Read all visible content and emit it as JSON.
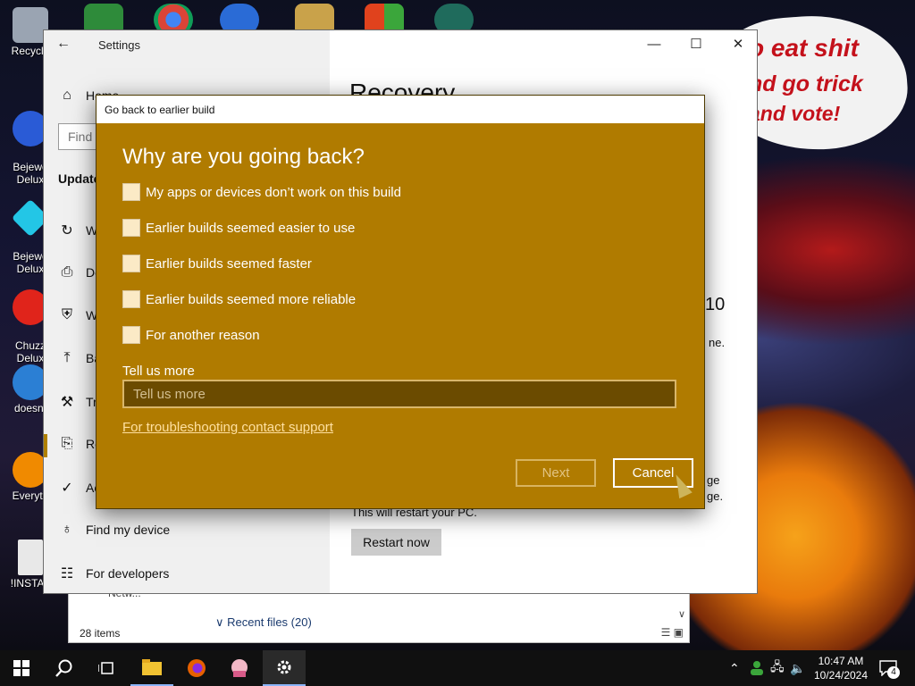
{
  "desktop": {
    "meme_lines": [
      "o eat shit",
      "nd go trick",
      "and vote!"
    ],
    "icons": [
      {
        "label": "Recycle",
        "icon": "recycle-bin-icon"
      },
      {
        "label": "Bejewe\nDelux",
        "icon": "bejeweled-icon"
      },
      {
        "label": "Bejewe\nDelux",
        "icon": "bejeweled-3-icon"
      },
      {
        "label": "Chuzz\nDelux",
        "icon": "chuzzle-icon"
      },
      {
        "label": "doesnt",
        "icon": "bird-icon"
      },
      {
        "label": "Everyth",
        "icon": "everything-search-icon"
      },
      {
        "label": "!INSTAL",
        "icon": "document-icon"
      }
    ]
  },
  "explorer": {
    "item_count": "28 items",
    "recent_files": "∨ Recent files (20)",
    "network_peek": "Netw..."
  },
  "settings": {
    "window_title": "Settings",
    "back_glyph": "←",
    "nav": [
      {
        "label": "Home",
        "icon": "home-icon",
        "glyph": "⌂"
      },
      {
        "label": "W",
        "icon": "sync-icon",
        "glyph": "↻"
      },
      {
        "label": "De",
        "icon": "delivery-icon",
        "glyph": "⎙"
      },
      {
        "label": "W",
        "icon": "shield-icon",
        "glyph": "⛨"
      },
      {
        "label": "Ba",
        "icon": "backup-icon",
        "glyph": "⤒"
      },
      {
        "label": "Tr",
        "icon": "wrench-icon",
        "glyph": "⚒"
      },
      {
        "label": "Re",
        "icon": "recovery-icon",
        "glyph": "⎘"
      },
      {
        "label": "Ac",
        "icon": "check-circle-icon",
        "glyph": "✓"
      },
      {
        "label": "Find my device",
        "icon": "person-pin-icon",
        "glyph": "♁"
      },
      {
        "label": "For developers",
        "icon": "developer-icon",
        "glyph": "☷"
      }
    ],
    "find_placeholder": "Find",
    "section_head": "Update",
    "page_title": "Recovery",
    "peek_10": "10",
    "peek_ne": "ne.",
    "peek_ge1": "ge",
    "peek_ge2": "ge.",
    "restart_note": "This will restart your PC.",
    "restart_button": "Restart now",
    "minimize": "—",
    "maximize": "☐",
    "close": "✕"
  },
  "dialog": {
    "title": "Go back to earlier build",
    "heading": "Why are you going back?",
    "options": [
      "My apps or devices don’t work on this build",
      "Earlier builds seemed easier to use",
      "Earlier builds seemed faster",
      "Earlier builds seemed more reliable",
      "For another reason"
    ],
    "tell_label": "Tell us more",
    "tell_placeholder": "Tell us more",
    "support_link": "For troubleshooting contact support",
    "next_button": "Next",
    "cancel_button": "Cancel"
  },
  "taskbar": {
    "time": "10:47 AM",
    "date": "10/24/2024",
    "notification_count": "4"
  },
  "colors": {
    "dialog_bg": "#b07b00",
    "accent": "#b08000"
  }
}
